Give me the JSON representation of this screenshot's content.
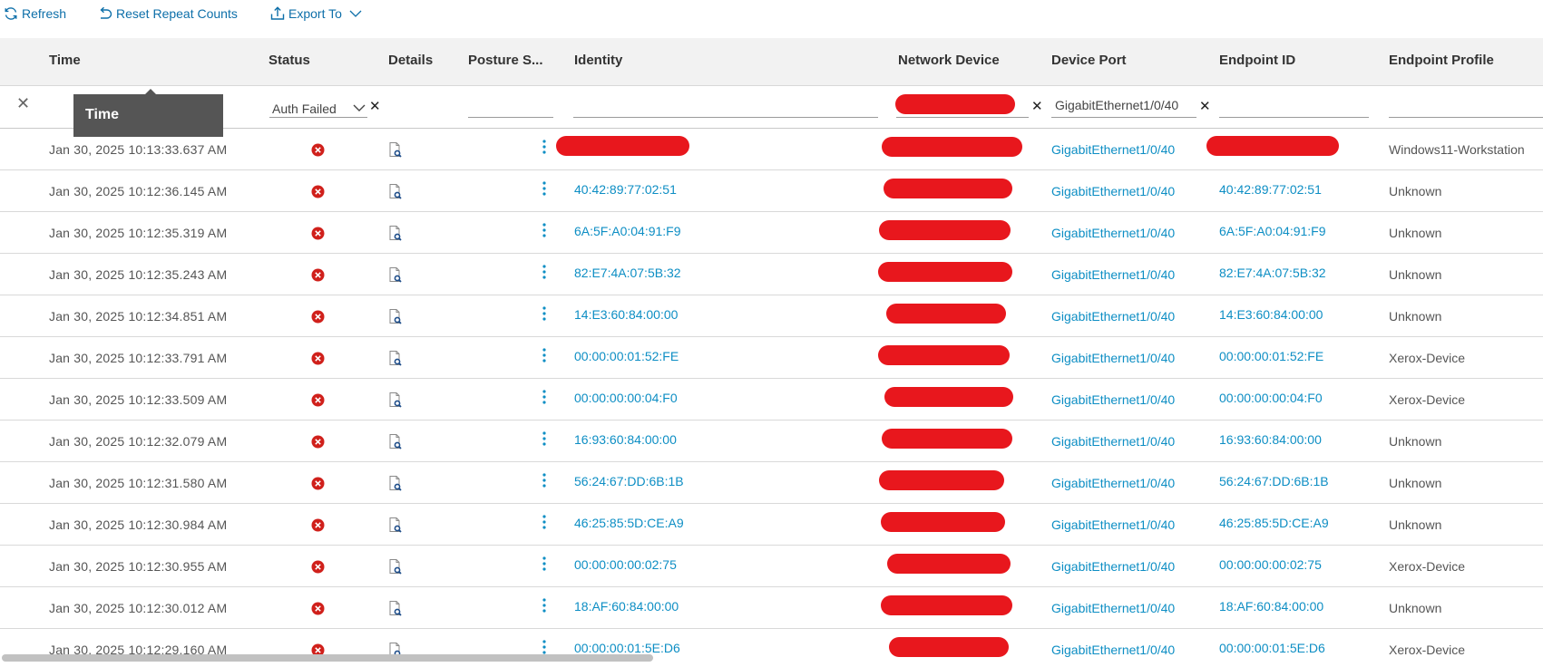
{
  "toolbar": {
    "refresh_label": "Refresh",
    "reset_label": "Reset Repeat Counts",
    "export_label": "Export To"
  },
  "columns": {
    "time": "Time",
    "status": "Status",
    "details": "Details",
    "posture": "Posture S...",
    "identity": "Identity",
    "network_device": "Network Device",
    "device_port": "Device Port",
    "endpoint_id": "Endpoint ID",
    "endpoint_profile": "Endpoint Profile"
  },
  "filters": {
    "status_value": "Auth Failed",
    "device_port_value": "GigabitEthernet1/0/40"
  },
  "tooltip": {
    "text": "Time"
  },
  "colors": {
    "link": "#0d8ec4",
    "toolbar_link": "#0d6fa9",
    "status_failed": "#d0201b",
    "redaction": "#e8171d"
  },
  "rows": [
    {
      "time": "Jan 30, 2025 10:13:33.637 AM",
      "identity": "",
      "device_port": "GigabitEthernet1/0/40",
      "endpoint_id": "",
      "profile": "Windows11-Workstation"
    },
    {
      "time": "Jan 30, 2025 10:12:36.145 AM",
      "identity": "40:42:89:77:02:51",
      "device_port": "GigabitEthernet1/0/40",
      "endpoint_id": "40:42:89:77:02:51",
      "profile": "Unknown"
    },
    {
      "time": "Jan 30, 2025 10:12:35.319 AM",
      "identity": "6A:5F:A0:04:91:F9",
      "device_port": "GigabitEthernet1/0/40",
      "endpoint_id": "6A:5F:A0:04:91:F9",
      "profile": "Unknown"
    },
    {
      "time": "Jan 30, 2025 10:12:35.243 AM",
      "identity": "82:E7:4A:07:5B:32",
      "device_port": "GigabitEthernet1/0/40",
      "endpoint_id": "82:E7:4A:07:5B:32",
      "profile": "Unknown"
    },
    {
      "time": "Jan 30, 2025 10:12:34.851 AM",
      "identity": "14:E3:60:84:00:00",
      "device_port": "GigabitEthernet1/0/40",
      "endpoint_id": "14:E3:60:84:00:00",
      "profile": "Unknown"
    },
    {
      "time": "Jan 30, 2025 10:12:33.791 AM",
      "identity": "00:00:00:01:52:FE",
      "device_port": "GigabitEthernet1/0/40",
      "endpoint_id": "00:00:00:01:52:FE",
      "profile": "Xerox-Device"
    },
    {
      "time": "Jan 30, 2025 10:12:33.509 AM",
      "identity": "00:00:00:00:04:F0",
      "device_port": "GigabitEthernet1/0/40",
      "endpoint_id": "00:00:00:00:04:F0",
      "profile": "Xerox-Device"
    },
    {
      "time": "Jan 30, 2025 10:12:32.079 AM",
      "identity": "16:93:60:84:00:00",
      "device_port": "GigabitEthernet1/0/40",
      "endpoint_id": "16:93:60:84:00:00",
      "profile": "Unknown"
    },
    {
      "time": "Jan 30, 2025 10:12:31.580 AM",
      "identity": "56:24:67:DD:6B:1B",
      "device_port": "GigabitEthernet1/0/40",
      "endpoint_id": "56:24:67:DD:6B:1B",
      "profile": "Unknown"
    },
    {
      "time": "Jan 30, 2025 10:12:30.984 AM",
      "identity": "46:25:85:5D:CE:A9",
      "device_port": "GigabitEthernet1/0/40",
      "endpoint_id": "46:25:85:5D:CE:A9",
      "profile": "Unknown"
    },
    {
      "time": "Jan 30, 2025 10:12:30.955 AM",
      "identity": "00:00:00:00:02:75",
      "device_port": "GigabitEthernet1/0/40",
      "endpoint_id": "00:00:00:00:02:75",
      "profile": "Xerox-Device"
    },
    {
      "time": "Jan 30, 2025 10:12:30.012 AM",
      "identity": "18:AF:60:84:00:00",
      "device_port": "GigabitEthernet1/0/40",
      "endpoint_id": "18:AF:60:84:00:00",
      "profile": "Unknown"
    },
    {
      "time": "Jan 30, 2025 10:12:29.160 AM",
      "identity": "00:00:00:01:5E:D6",
      "device_port": "GigabitEthernet1/0/40",
      "endpoint_id": "00:00:00:01:5E:D6",
      "profile": "Xerox-Device"
    }
  ]
}
